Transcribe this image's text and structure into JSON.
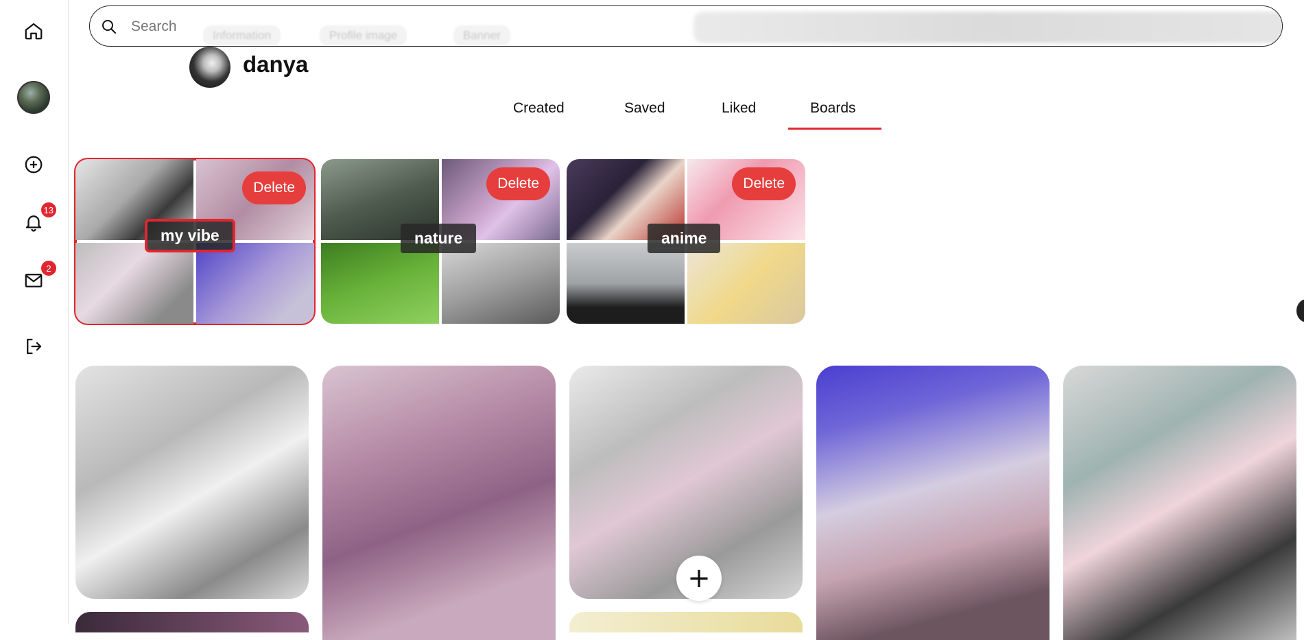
{
  "sidebar": {
    "items": [
      {
        "name": "home-icon",
        "label": "Home"
      },
      {
        "name": "avatar",
        "label": "Profile"
      },
      {
        "name": "create-icon",
        "label": "Create"
      },
      {
        "name": "notifications-icon",
        "label": "Notifications",
        "badge": "13"
      },
      {
        "name": "messages-icon",
        "label": "Messages",
        "badge": "2"
      },
      {
        "name": "logout-icon",
        "label": "Log out"
      }
    ]
  },
  "search": {
    "placeholder": "Search",
    "ghost_chips": [
      "Information",
      "Profile image",
      "Banner"
    ]
  },
  "profile": {
    "name": "danya"
  },
  "tabs": [
    {
      "label": "Created"
    },
    {
      "label": "Saved"
    },
    {
      "label": "Liked"
    },
    {
      "label": "Boards",
      "active": true
    }
  ],
  "boards": [
    {
      "title": "my vibe",
      "delete_label": "Delete",
      "selected": true
    },
    {
      "title": "nature",
      "delete_label": "Delete",
      "selected": false
    },
    {
      "title": "anime",
      "delete_label": "Delete",
      "selected": false
    }
  ],
  "pins": [
    {
      "name": "pin-monster-zero-sketch"
    },
    {
      "name": "pin-monster-pipeline-pink"
    },
    {
      "name": "pin-monster-keychain"
    },
    {
      "name": "pin-monster-kiko-figure"
    },
    {
      "name": "pin-anime-can"
    }
  ],
  "add_button_label": "+",
  "colors": {
    "accent": "#e0262f",
    "delete": "#e63d3d"
  }
}
